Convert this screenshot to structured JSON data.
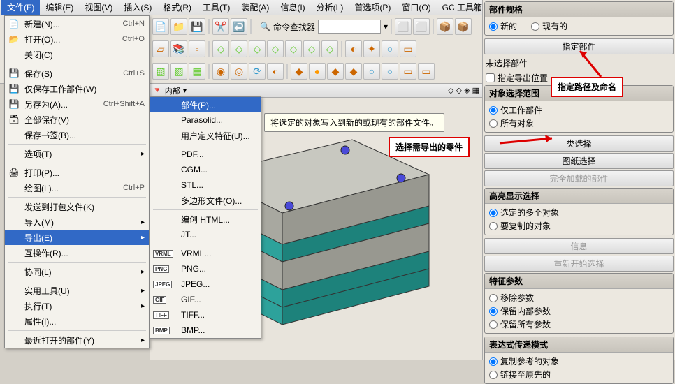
{
  "menubar": [
    "文件(F)",
    "编辑(E)",
    "视图(V)",
    "插入(S)",
    "格式(R)",
    "工具(T)",
    "装配(A)",
    "信息(I)",
    "分析(L)",
    "首选项(P)",
    "窗口(O)",
    "GC 工具箱"
  ],
  "menubar_active_index": 0,
  "cmd_finder": {
    "label": "命令查找器",
    "placeholder": ""
  },
  "file_menu": [
    {
      "label": "新建(N)...",
      "shortcut": "Ctrl+N",
      "icon": "new"
    },
    {
      "label": "打开(O)...",
      "shortcut": "Ctrl+O",
      "icon": "open"
    },
    {
      "label": "关闭(C)",
      "shortcut": ""
    },
    {
      "sep": true
    },
    {
      "label": "保存(S)",
      "shortcut": "Ctrl+S",
      "icon": "save"
    },
    {
      "label": "仅保存工作部件(W)",
      "shortcut": "",
      "icon": "save2"
    },
    {
      "label": "另存为(A)...",
      "shortcut": "Ctrl+Shift+A",
      "icon": "saveas"
    },
    {
      "label": "全部保存(V)",
      "shortcut": "",
      "icon": "saveall"
    },
    {
      "label": "保存书签(B)...",
      "shortcut": ""
    },
    {
      "sep": true
    },
    {
      "label": "选项(T)",
      "arrow": true
    },
    {
      "sep": true
    },
    {
      "label": "打印(P)...",
      "shortcut": "",
      "icon": "print"
    },
    {
      "label": "绘图(L)...",
      "shortcut": "Ctrl+P"
    },
    {
      "sep": true
    },
    {
      "label": "发送到打包文件(K)",
      "shortcut": ""
    },
    {
      "label": "导入(M)",
      "arrow": true
    },
    {
      "label": "导出(E)",
      "arrow": true,
      "hl": true
    },
    {
      "label": "互操作(R)...",
      "shortcut": ""
    },
    {
      "sep": true
    },
    {
      "label": "协同(L)",
      "arrow": true
    },
    {
      "sep": true
    },
    {
      "label": "实用工具(U)",
      "arrow": true
    },
    {
      "label": "执行(T)",
      "arrow": true
    },
    {
      "label": "属性(I)...",
      "shortcut": ""
    },
    {
      "sep": true
    },
    {
      "label": "最近打开的部件(Y)",
      "arrow": true
    }
  ],
  "sub_menu": [
    {
      "label": "部件(P)...",
      "hl": true
    },
    {
      "label": "Parasolid..."
    },
    {
      "label": "用户定义特征(U)..."
    },
    {
      "sep": true
    },
    {
      "label": "PDF..."
    },
    {
      "label": "CGM..."
    },
    {
      "label": "STL..."
    },
    {
      "label": "多边形文件(O)..."
    },
    {
      "sep": true
    },
    {
      "label": "编创 HTML..."
    },
    {
      "label": "JT..."
    },
    {
      "sep": true
    },
    {
      "label": "VRML...",
      "badge": "VRML"
    },
    {
      "label": "PNG...",
      "badge": "PNG"
    },
    {
      "label": "JPEG...",
      "badge": "JPEG"
    },
    {
      "label": "GIF...",
      "badge": "GIF"
    },
    {
      "label": "TIFF...",
      "badge": "TIFF"
    },
    {
      "label": "BMP...",
      "badge": "BMP"
    }
  ],
  "tooltip_text": "将选定的对象写入到新的或现有的部件文件。",
  "viewport": {
    "tab": "内部"
  },
  "right_panel": {
    "spec": {
      "title": "部件规格",
      "opt1": "新的",
      "opt2": "现有的",
      "checked": 0
    },
    "specify_btn": "指定部件",
    "no_select": "未选择部件",
    "export_loc": "指定导出位置",
    "scope": {
      "title": "对象选择范围",
      "opt1": "仅工作部件",
      "opt2": "所有对象",
      "checked": 0
    },
    "class_select": "类选择",
    "drawing_select": "图纸选择",
    "full_load": "完全加载的部件",
    "highlight": {
      "title": "高亮显示选择",
      "opt1": "选定的多个对象",
      "opt2": "要复制的对象",
      "checked": 0
    },
    "info_btn": "信息",
    "restart_btn": "重新开始选择",
    "feat_param": {
      "title": "特征参数",
      "opt1": "移除参数",
      "opt2": "保留内部参数",
      "opt3": "保留所有参数",
      "checked": 1
    },
    "expr_mode": {
      "title": "表达式传递模式",
      "opt1": "复制参考的对象",
      "opt2": "链接至原先的",
      "checked": 0
    }
  },
  "annotations": {
    "a1": "指定路径及命名",
    "a2": "选择需导出的零件"
  }
}
